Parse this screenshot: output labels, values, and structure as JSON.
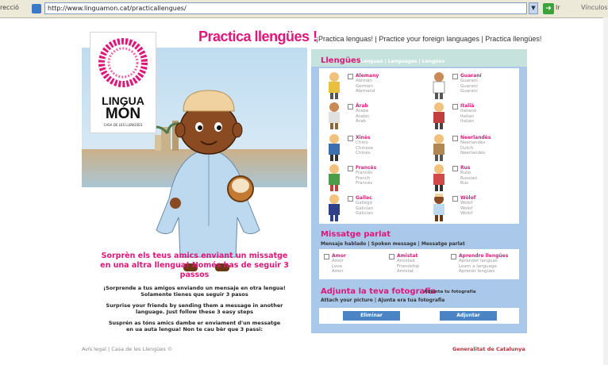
{
  "browser": {
    "address_label": "recció",
    "url": "http://www.linguamon.cat/practicallengues/",
    "go_label": "Ir",
    "links_label": "Vínculos"
  },
  "header": {
    "title": "Practica llengües !",
    "subnav": "¡Practica lenguas!  |  Practice your foreign languages  |  Practica llengües!"
  },
  "logo": {
    "line1": "LINGUA",
    "line2": "MÓN",
    "line3": "CASA DE LES LLENGÜES"
  },
  "promo": {
    "catalan_1": "Sorprèn els teus amics enviant un missatge",
    "catalan_2": "en una altra llengua! Només has de seguir 3 passos",
    "spanish_1": "¡Sorprende a tus amigos enviando un mensaje en otra lengua!",
    "spanish_2": "Solamente tienes que seguir 3 pasos",
    "english_1": "Surprise your friends by sending them a message in another",
    "english_2": "language. Just follow these 3 easy steps",
    "occitan_1": "Susprén as tóns amics dambe er enviament d'un messatge",
    "occitan_2": "en ua auta lengua! Non te cau bèr que 3 passi:"
  },
  "languages": {
    "title": "Llengües",
    "subtitle": "Lenguas | Languages | Lengües",
    "items": [
      {
        "name": "Alemany",
        "translations": "Alemán\nGerman\nAlemand"
      },
      {
        "name": "Guaraní",
        "translations": "Guaraní\nGuarani\nGuaraní"
      },
      {
        "name": "Àrab",
        "translations": "Árabe\nArabic\nÀrab"
      },
      {
        "name": "Italià",
        "translations": "Italiano\nItalian\nItalian"
      },
      {
        "name": "Xinès",
        "translations": "Chino\nChinese\nChinés"
      },
      {
        "name": "Neerlandès",
        "translations": "Neerlandés\nDutch\nNeerlandés"
      },
      {
        "name": "Francès",
        "translations": "Francés\nFrench\nFrancés"
      },
      {
        "name": "Rus",
        "translations": "Ruso\nRussian\nRus"
      },
      {
        "name": "Gallec",
        "translations": "Gallego\nGalician\nGalician"
      },
      {
        "name": "Wòlof",
        "translations": "Wolof\nWolof\nWolof"
      }
    ]
  },
  "message": {
    "title": "Missatge parlat",
    "subtitle": "Mensaje hablado | Spoken message | Messatge parlat",
    "items": [
      {
        "name": "Amor",
        "translations": "Amor\nLove\nAmor"
      },
      {
        "name": "Amistat",
        "translations": "Amistad\nFriendship\nAmistat"
      },
      {
        "name": "Aprendre llengües",
        "translations": "Aprender lenguas\nLearn a language\nAprenèr lengües"
      }
    ]
  },
  "photo": {
    "title": "Adjunta la teva fotografia",
    "tag": "Adjunta tu fotografía",
    "subtitle": "Attach your picture | Ajunta era tua fotografia",
    "remove_label": "Eliminar",
    "attach_label": "Adjuntar"
  },
  "footer": {
    "left": "Avís legal | Casa de les Llengües ©",
    "right": "Generalitat de Catalunya"
  },
  "colors": {
    "accent": "#e0177a",
    "panel": "#a9c8ea",
    "button": "#4a84c4"
  }
}
